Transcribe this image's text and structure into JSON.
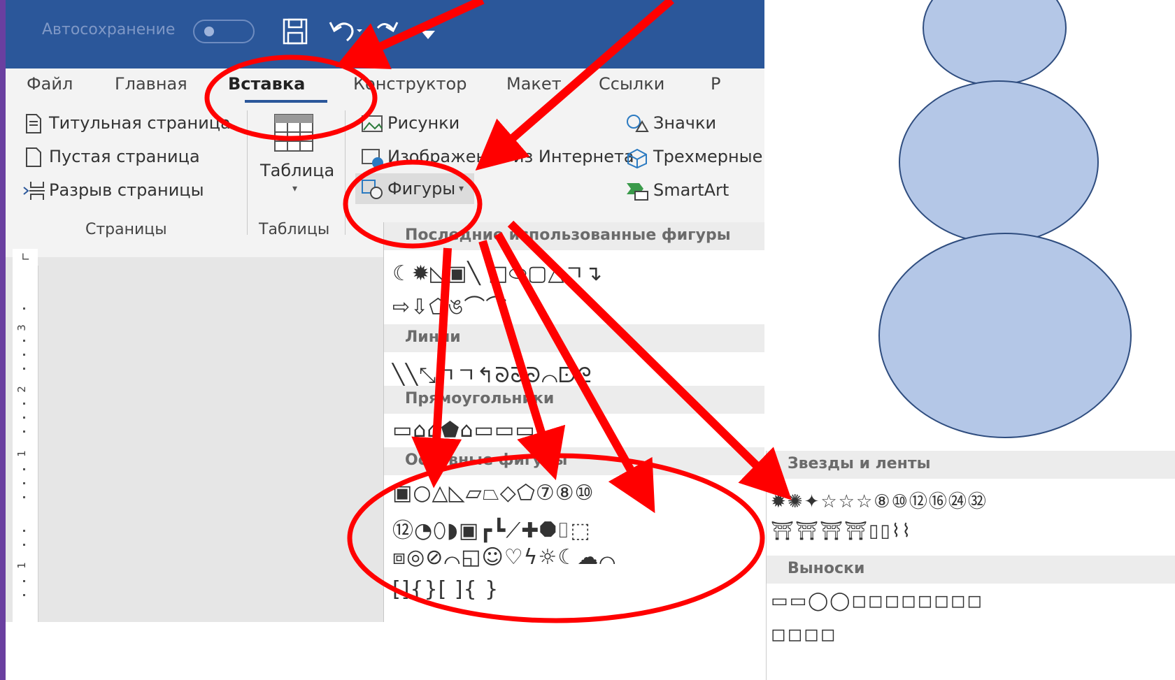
{
  "colors": {
    "title_bar": "#2b579a",
    "ribbon": "#f3f3f3",
    "accent_red": "#ff0000",
    "snowman_fill": "#b4c7e7",
    "snowman_stroke": "#2f4d7f"
  },
  "titlebar": {
    "autosave_label": "Автосохранение"
  },
  "tabs": [
    "Файл",
    "Главная",
    "Вставка",
    "Конструктор",
    "Макет",
    "Ссылки",
    "Р"
  ],
  "active_tab": "Вставка",
  "ribbon": {
    "pages": {
      "cover": "Титульная страница",
      "blank": "Пустая страница",
      "break": "Разрыв страницы",
      "label": "Страницы"
    },
    "tables": {
      "table": "Таблица",
      "label": "Таблицы"
    },
    "illustrations": {
      "pictures": "Рисунки",
      "online": "Изображения из Интернета",
      "shapes": "Фигуры",
      "icons": "Значки",
      "models": "Трехмерные",
      "smartart": "SmartArt"
    }
  },
  "ruler_numbers": [
    "3",
    "2",
    "1",
    "1"
  ],
  "shapes_menu": {
    "recent": {
      "title": "Последние использованные фигуры",
      "rows": [
        "☾✹◺▣╲ □⬭▢△ㄱ↴",
        "⇨⇩⬠ঙ⌒⌒"
      ]
    },
    "lines": {
      "title": "Линии",
      "rows": [
        "╲╲⤡ㄱㄱ↰ᘐᘐᘐ⌒ᗠᘓ"
      ]
    },
    "rect": {
      "title": "Прямоугольники",
      "rows": [
        "▭⌂⌂⬟⌂▭▭▭"
      ]
    },
    "basic": {
      "title": "Основные фигуры",
      "rows": [
        "▣○△◺▱⏢◇⬠⑦⑧⑩",
        "⑫◔⬯◗▣┏┗⟋✚⯃⌷⬚",
        "⧈◎⊘⌒◱☺♡ϟ☼☾☁⌒",
        "[]{}[ ]{ }"
      ]
    }
  },
  "callouts_menu": {
    "stars_title": "Звезды и ленты",
    "stars_rows": [
      "✹✺✦☆☆☆⑧⑩⑫⑯㉔㉜",
      "⛩⛩⛩⛩▯▯⌇⌇"
    ],
    "callouts_title": "Выноски",
    "callouts_rows": [
      "▭▭◯◯◻◻◻◻◻◻◻◻",
      "◻◻◻◻"
    ]
  }
}
